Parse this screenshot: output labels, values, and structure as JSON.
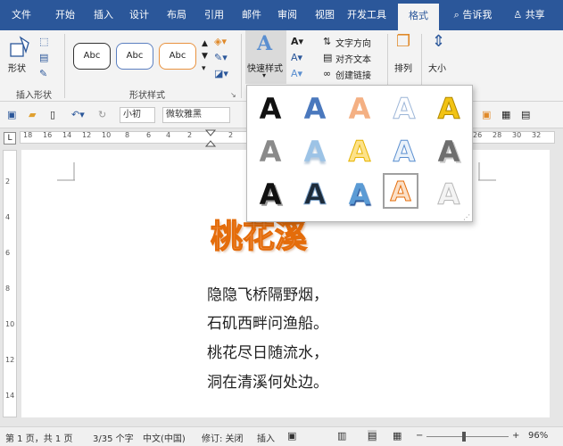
{
  "tabs": [
    "文件",
    "开始",
    "插入",
    "设计",
    "布局",
    "引用",
    "邮件",
    "审阅",
    "视图",
    "开发工具",
    "格式"
  ],
  "tab_right": {
    "search": "告诉我",
    "share": "共享"
  },
  "ribbon": {
    "shapes_label": "形状",
    "insert_shapes_group": "插入形状",
    "shape_styles_group": "形状样式",
    "style_sample": "Abc",
    "quick_styles": "快速样式",
    "text_direction": "文字方向",
    "align_text": "对齐文本",
    "create_link": "创建链接",
    "arrange": "排列",
    "size": "大小"
  },
  "qat": {
    "font_size": "小初",
    "font_name": "微软雅黑"
  },
  "ruler_numbers": [
    "18",
    "16",
    "14",
    "12",
    "10",
    "8",
    "6",
    "4",
    "2",
    "2",
    "26",
    "28",
    "30",
    "32"
  ],
  "vruler_numbers": [
    "2",
    "4",
    "6",
    "8",
    "10",
    "12",
    "14"
  ],
  "gallery": {
    "glyph": "A",
    "selected_index": 13
  },
  "document": {
    "title": "桃花溪",
    "lines": [
      "隐隐飞桥隔野烟，",
      "石矶西畔问渔船。",
      "桃花尽日随流水，",
      "洞在清溪何处边。"
    ]
  },
  "status": {
    "page": "第 1 页，共 1 页",
    "words": "3/35 个字",
    "language": "中文(中国)",
    "track": "修订: 关闭",
    "mode": "插入",
    "zoom": "96%"
  },
  "colors": {
    "accent": "#2b579a",
    "title_fill": "#f4b083",
    "title_outline": "#e46c0a"
  }
}
